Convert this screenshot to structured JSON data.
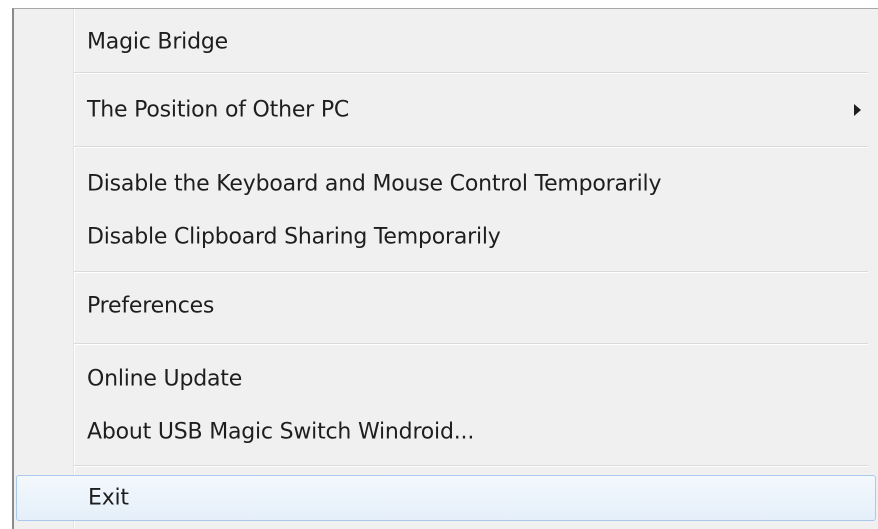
{
  "menu": {
    "items": [
      {
        "label": "Magic Bridge"
      },
      {
        "label": "The Position of Other PC",
        "submenu_icon": "submenu-arrow-icon"
      },
      {
        "label": "Disable the Keyboard and Mouse Control Temporarily"
      },
      {
        "label": "Disable Clipboard Sharing Temporarily"
      },
      {
        "label": "Preferences"
      },
      {
        "label": "Online Update"
      },
      {
        "label": "About USB Magic Switch Windroid..."
      },
      {
        "label": "Exit",
        "state": "highlighted"
      }
    ]
  },
  "colors": {
    "menu_background": "#f0f0f0",
    "text": "#1e1e1e",
    "highlight_border": "#a9c9ef",
    "highlight_fill": "#e5eff9"
  }
}
